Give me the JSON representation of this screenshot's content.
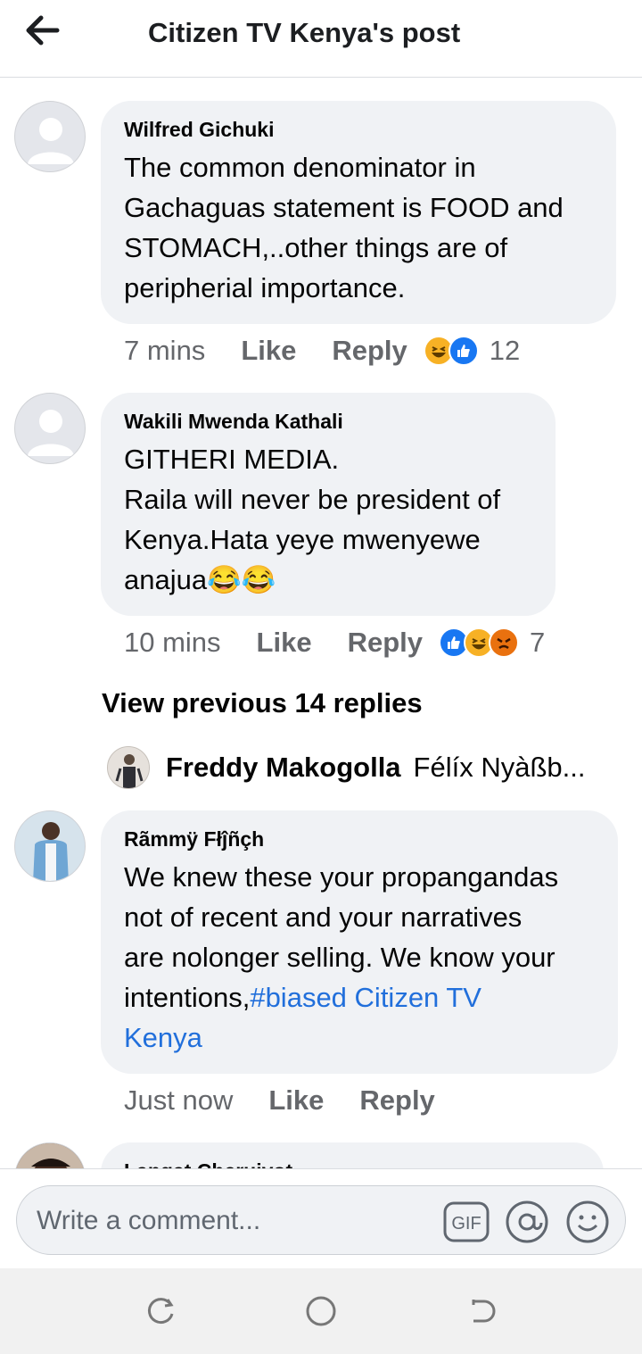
{
  "header": {
    "title": "Citizen TV Kenya's post"
  },
  "comments": [
    {
      "author": "Wilfred Gichuki",
      "text": "The common denominator in\nGachaguas statement is FOOD and\nSTOMACH,..other things are of\nperipherial importance.",
      "time": "7 mins",
      "like_label": "Like",
      "reply_label": "Reply",
      "reactions": [
        "haha",
        "like"
      ],
      "reaction_count": "12"
    },
    {
      "author": "Wakili Mwenda Kathali",
      "text": "GITHERI MEDIA.\nRaila will never be president of\nKenya.Hata yeye mwenyewe\nanajua😂😂",
      "time": "10 mins",
      "like_label": "Like",
      "reply_label": "Reply",
      "reactions": [
        "like",
        "haha",
        "angry"
      ],
      "reaction_count": "7"
    },
    {
      "author": "Rãmmÿ Fłĵñçh",
      "text_prefix": "We knew these your propangandas\nnot of recent and your narratives\nare nolonger selling. We know your\nintentions,",
      "hashtag": "#biased",
      "mention_1": "Citizen TV",
      "mention_2": "Kenya",
      "time": "Just now",
      "like_label": "Like",
      "reply_label": "Reply"
    },
    {
      "author": "Langat Cheruiyot"
    }
  ],
  "view_previous": "View previous 14 replies",
  "reply_preview": {
    "name": "Freddy Makogolla",
    "text": "Félíx Nyàßb..."
  },
  "composer": {
    "placeholder": "Write a comment...",
    "gif_label": "GIF"
  },
  "icons": {
    "back": "arrow-left-icon",
    "gif": "gif-icon",
    "mention": "at-sign-icon",
    "emoji": "smiley-icon",
    "nav_recent": "recent-apps-icon",
    "nav_home": "home-circle-icon",
    "nav_back": "back-nav-icon"
  },
  "colors": {
    "link": "#216fdb",
    "like": "#1877f2",
    "haha": "#f7b125",
    "angry": "#e9710f",
    "bubble": "#f0f2f5",
    "meta": "#65676b"
  }
}
